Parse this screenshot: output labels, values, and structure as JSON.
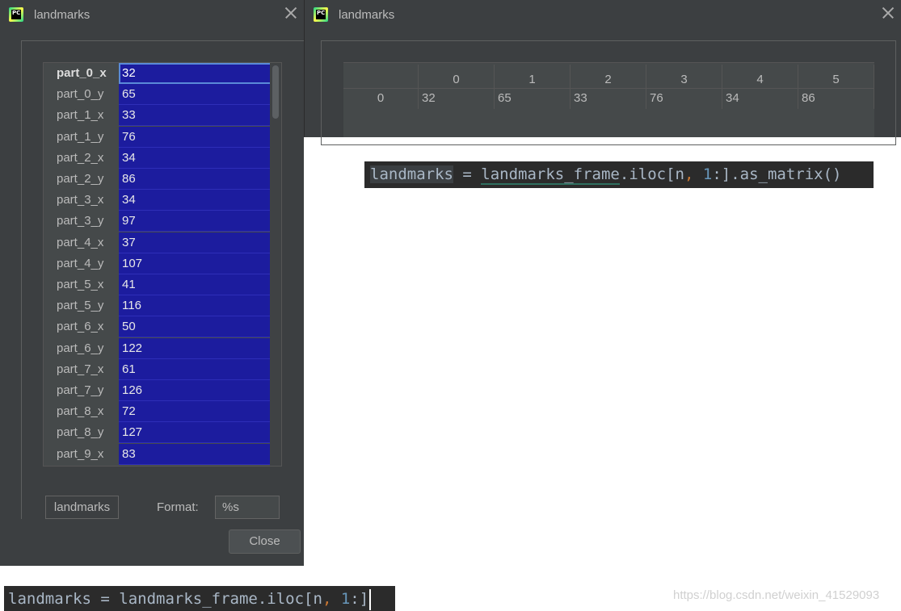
{
  "window_left": {
    "title": "landmarks",
    "table_rows": [
      {
        "label": "part_0_x",
        "value": "32"
      },
      {
        "label": "part_0_y",
        "value": "65"
      },
      {
        "label": "part_1_x",
        "value": "33"
      },
      {
        "label": "part_1_y",
        "value": "76"
      },
      {
        "label": "part_2_x",
        "value": "34"
      },
      {
        "label": "part_2_y",
        "value": "86"
      },
      {
        "label": "part_3_x",
        "value": "34"
      },
      {
        "label": "part_3_y",
        "value": "97"
      },
      {
        "label": "part_4_x",
        "value": "37"
      },
      {
        "label": "part_4_y",
        "value": "107"
      },
      {
        "label": "part_5_x",
        "value": "41"
      },
      {
        "label": "part_5_y",
        "value": "116"
      },
      {
        "label": "part_6_x",
        "value": "50"
      },
      {
        "label": "part_6_y",
        "value": "122"
      },
      {
        "label": "part_7_x",
        "value": "61"
      },
      {
        "label": "part_7_y",
        "value": "126"
      },
      {
        "label": "part_8_x",
        "value": "72"
      },
      {
        "label": "part_8_y",
        "value": "127"
      },
      {
        "label": "part_9_x",
        "value": "83"
      }
    ],
    "variable_name": "landmarks",
    "format_label": "Format:",
    "format_value": "%s",
    "close_button": "Close"
  },
  "window_right": {
    "title": "landmarks",
    "column_headers": [
      "0",
      "1",
      "2",
      "3",
      "4",
      "5"
    ],
    "row_index": "0",
    "row_values": [
      "32",
      "65",
      "33",
      "76",
      "34",
      "86"
    ]
  },
  "code_top": {
    "var": "landmarks",
    "eq": " = ",
    "expr_a": "landmarks_frame",
    "expr_b": ".iloc[n",
    "comma": ",",
    "space": " ",
    "num": "1",
    "expr_c": ":].as_matrix()"
  },
  "code_bottom": {
    "text_a": "landmarks = landmarks_frame.iloc[n",
    "comma": ",",
    "space": " ",
    "num": "1",
    "text_b": ":]"
  },
  "watermark": "https://blog.csdn.net/weixin_41529093",
  "colors": {
    "dialog_bg": "#3c3f41",
    "selection_blue": "#1c1c9e",
    "code_bg": "#2b2b2b"
  }
}
